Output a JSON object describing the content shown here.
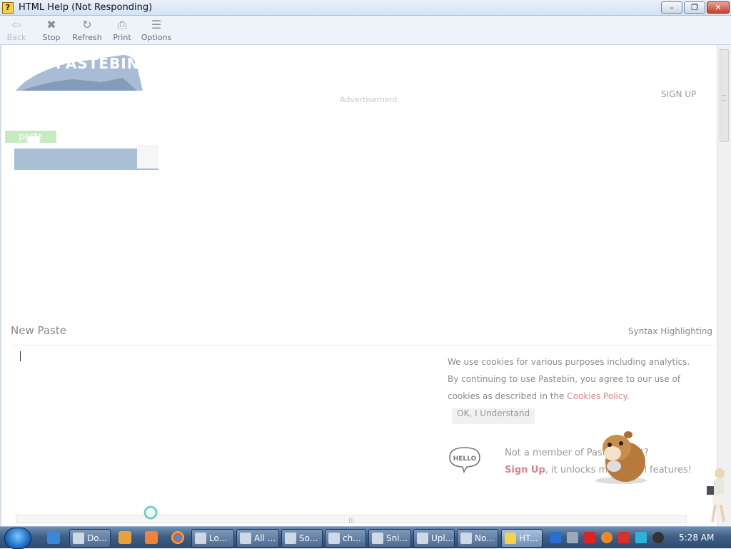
{
  "window": {
    "title": "HTML Help (Not Responding)",
    "app_icon": "help-icon",
    "controls": {
      "minimize": "–",
      "maximize": "❐",
      "close": "✕"
    }
  },
  "toolbar": {
    "buttons": [
      {
        "label": "Back",
        "icon": "arrow-left-icon",
        "glyph": "⇦",
        "enabled": false
      },
      {
        "label": "Stop",
        "icon": "stop-icon",
        "glyph": "✖",
        "enabled": true
      },
      {
        "label": "Refresh",
        "icon": "refresh-icon",
        "glyph": "↻",
        "enabled": true
      },
      {
        "label": "Print",
        "icon": "printer-icon",
        "glyph": "⎙",
        "enabled": true
      },
      {
        "label": "Options",
        "icon": "options-icon",
        "glyph": "☰",
        "enabled": true
      }
    ]
  },
  "page": {
    "logo_text": "PASTEBIN",
    "advertisement": "Advertisement",
    "sign_up": "SIGN UP",
    "paste_tab": "paste",
    "new_paste": "New Paste",
    "syntax_highlighting": "Syntax Highlighting",
    "cookie": {
      "text_before": "We use cookies for various purposes including analytics. By continuing to use Pastebin, you agree to our use of cookies as described in the ",
      "link": "Cookies Policy",
      "text_after": ".",
      "ok_button": "OK, I Understand"
    },
    "hello_badge": "HELLO",
    "member_line1": "Not a member of Pastebin yet?",
    "member_signup": "Sign Up",
    "member_line2": ", it unlocks many cool features!"
  },
  "taskbar": {
    "tasks": [
      {
        "label": "Do...",
        "icon": "document-icon"
      },
      {
        "label": "Lo...",
        "icon": "folder-icon"
      },
      {
        "label": "All ...",
        "icon": "window-icon"
      },
      {
        "label": "So...",
        "icon": "bird-icon"
      },
      {
        "label": "ch...",
        "icon": "chat-icon"
      },
      {
        "label": "Sni...",
        "icon": "snipping-icon"
      },
      {
        "label": "Upl...",
        "icon": "upload-icon"
      },
      {
        "label": "No...",
        "icon": "notepad-icon"
      },
      {
        "label": "HT...",
        "icon": "help-icon",
        "active": true
      }
    ],
    "clock": "5:28 AM"
  },
  "colors": {
    "accent_pink": "#d9838d",
    "paste_green": "#c6ebc3",
    "search_blue": "#a8bfd6",
    "taskbar_blue": "#3e5f86"
  }
}
